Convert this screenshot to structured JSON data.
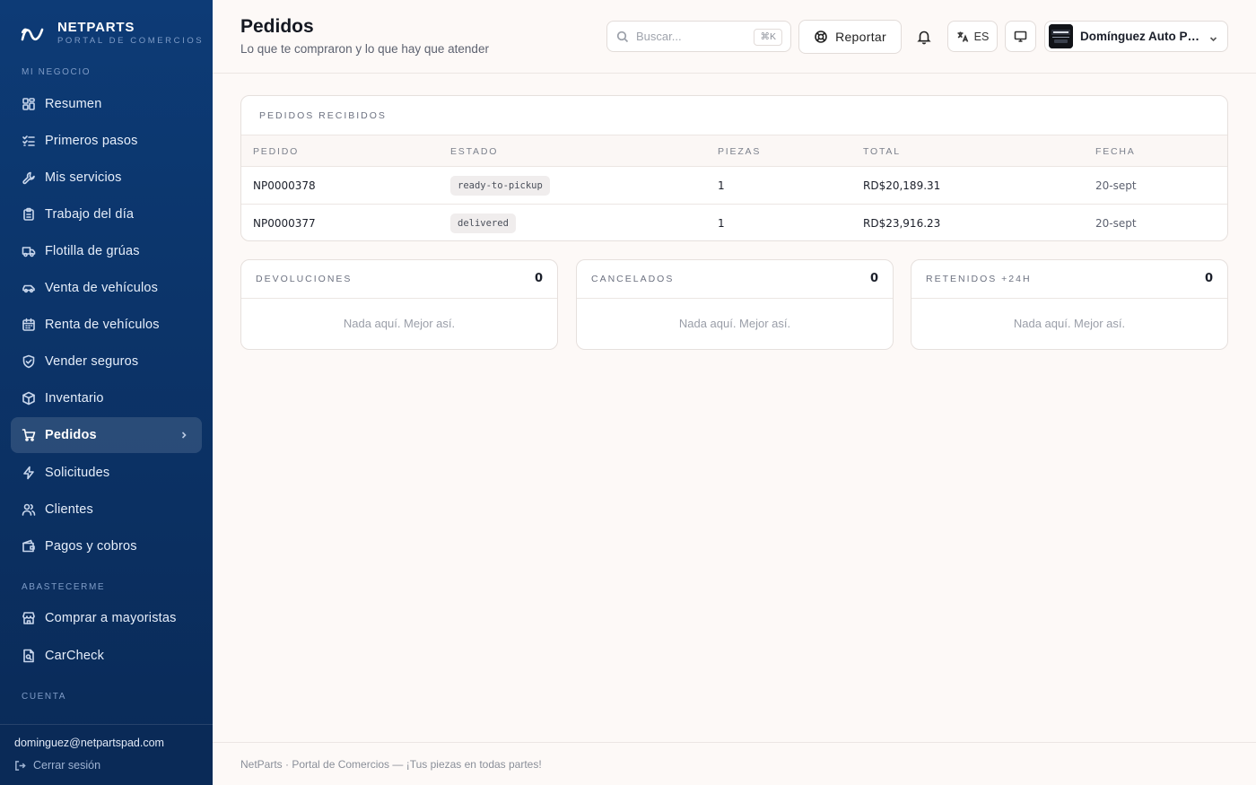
{
  "brand": {
    "name": "NETPARTS",
    "subtitle": "PORTAL DE COMERCIOS"
  },
  "sidebar": {
    "sections": [
      {
        "label": "MI NEGOCIO"
      },
      {
        "label": "ABASTECERME"
      },
      {
        "label": "CUENTA"
      }
    ],
    "items": [
      {
        "label": "Resumen",
        "icon": "grid-icon"
      },
      {
        "label": "Primeros pasos",
        "icon": "checklist-icon"
      },
      {
        "label": "Mis servicios",
        "icon": "wrench-icon"
      },
      {
        "label": "Trabajo del día",
        "icon": "clipboard-icon"
      },
      {
        "label": "Flotilla de grúas",
        "icon": "truck-icon"
      },
      {
        "label": "Venta de vehículos",
        "icon": "car-icon"
      },
      {
        "label": "Renta de vehículos",
        "icon": "calendar-icon"
      },
      {
        "label": "Vender seguros",
        "icon": "shield-icon"
      },
      {
        "label": "Inventario",
        "icon": "box-icon"
      },
      {
        "label": "Pedidos",
        "icon": "cart-icon",
        "active": true
      },
      {
        "label": "Solicitudes",
        "icon": "bolt-icon"
      },
      {
        "label": "Clientes",
        "icon": "users-icon"
      },
      {
        "label": "Pagos y cobros",
        "icon": "wallet-icon"
      },
      {
        "label": "Comprar a mayoristas",
        "icon": "store-icon"
      },
      {
        "label": "CarCheck",
        "icon": "document-search-icon"
      }
    ],
    "user_email": "dominguez@netpartspad.com",
    "logout_label": "Cerrar sesión"
  },
  "header": {
    "title": "Pedidos",
    "subtitle": "Lo que te compraron y lo que hay que atender",
    "search_placeholder": "Buscar...",
    "search_shortcut": "⌘K",
    "report_label": "Reportar",
    "language": "ES",
    "account_name": "Domínguez Auto Parts"
  },
  "orders": {
    "title": "PEDIDOS RECIBIDOS",
    "columns": [
      "PEDIDO",
      "ESTADO",
      "PIEZAS",
      "TOTAL",
      "FECHA"
    ],
    "rows": [
      {
        "id": "NP0000378",
        "status": "ready-to-pickup",
        "pieces": "1",
        "total": "RD$20,189.31",
        "date": "20-sept"
      },
      {
        "id": "NP0000377",
        "status": "delivered",
        "pieces": "1",
        "total": "RD$23,916.23",
        "date": "20-sept"
      }
    ]
  },
  "summary_cards": [
    {
      "title": "DEVOLUCIONES",
      "count": "0",
      "empty": "Nada aquí. Mejor así."
    },
    {
      "title": "CANCELADOS",
      "count": "0",
      "empty": "Nada aquí. Mejor así."
    },
    {
      "title": "RETENIDOS +24H",
      "count": "0",
      "empty": "Nada aquí. Mejor así."
    }
  ],
  "footer": {
    "text": "NetParts · Portal de Comercios — ¡Tus piezas en todas partes!"
  },
  "colors": {
    "sidebar_bg": "#0d3b76",
    "page_bg": "#fdf9f7",
    "badge_bg": "#f0eded"
  }
}
